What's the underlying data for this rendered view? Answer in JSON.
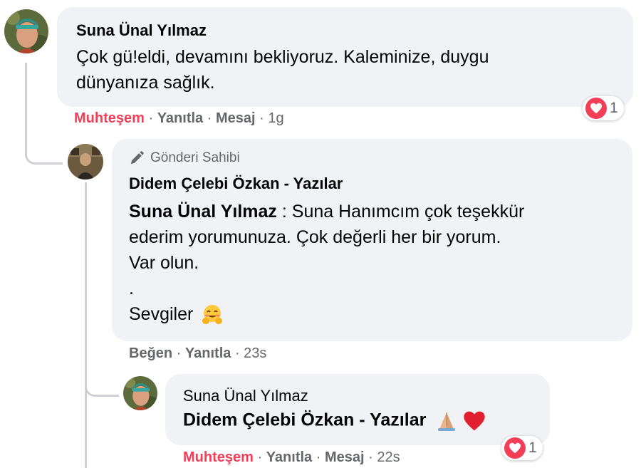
{
  "comments": [
    {
      "author": "Suna Ünal Yılmaz",
      "text_lines": [
        "Çok gü!eldi, devamını bekliyoruz. Kaleminize, duygu",
        "dünyanıza sağlık."
      ],
      "actions": {
        "reaction_label": "Muhteşem",
        "reply": "Yanıtla",
        "message": "Mesaj",
        "time": "1g"
      },
      "reaction_count": "1"
    },
    {
      "badge": "Gönderi Sahibi",
      "author": "Didem Çelebi Özkan - Yazılar",
      "mention": "Suna Ünal Yılmaz",
      "mention_sep": " : ",
      "text_first": "Suna Hanımcım çok teşekkür",
      "text_lines": [
        "ederim yorumunuza. Çok değerli her bir yorum.",
        "Var olun.",
        ".",
        "Sevgiler"
      ],
      "actions": {
        "like": "Beğen",
        "reply": "Yanıtla",
        "time": "23s"
      }
    },
    {
      "author": "Suna Ünal Yılmaz",
      "mention": "Didem Çelebi Özkan - Yazılar",
      "actions": {
        "reaction_label": "Muhteşem",
        "reply": "Yanıtla",
        "message": "Mesaj",
        "time": "22s"
      },
      "reaction_count": "1"
    }
  ],
  "separator": " · ",
  "icons": [
    "heart-icon",
    "pen-icon",
    "hugging-face-icon",
    "praying-hands-icon",
    "red-heart-icon"
  ],
  "colors": {
    "bubble": "#f0f2f5",
    "love": "#f33e58",
    "muted": "#65676b",
    "thread": "#ced0d4"
  }
}
